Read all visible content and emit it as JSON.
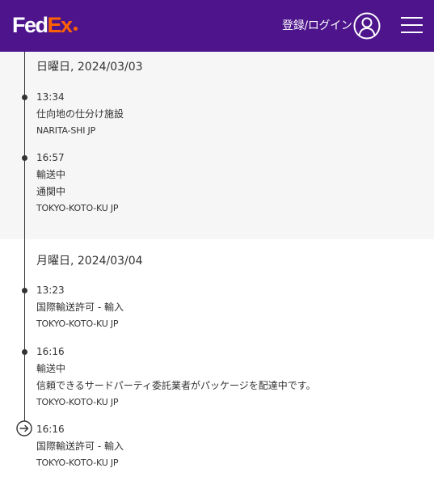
{
  "header": {
    "logo_fed": "Fed",
    "logo_ex": "Ex",
    "login_label": "登録/ログイン",
    "account_icon": "user-circle-icon",
    "menu_icon": "hamburger-menu-icon",
    "brand_color": "#4d148c",
    "accent_color": "#ff6200"
  },
  "timeline": {
    "days": [
      {
        "date": "日曜日, 2024/03/03",
        "events": [
          {
            "time": "13:34",
            "lines": [
              "仕向地の仕分け施設"
            ],
            "location": "NARITA-SHI JP"
          },
          {
            "time": "16:57",
            "lines": [
              "輸送中",
              "通関中"
            ],
            "location": "TOKYO-KOTO-KU JP"
          }
        ]
      },
      {
        "date": "月曜日, 2024/03/04",
        "events": [
          {
            "time": "13:23",
            "lines": [
              "国際輸送許可 - 輸入"
            ],
            "location": "TOKYO-KOTO-KU JP"
          },
          {
            "time": "16:16",
            "lines": [
              "輸送中",
              "信頼できるサードパーティ委託業者がパッケージを配達中です。"
            ],
            "location": "TOKYO-KOTO-KU JP"
          },
          {
            "time": "16:16",
            "lines": [
              "国際輸送許可 - 輸入"
            ],
            "location": "TOKYO-KOTO-KU JP",
            "marker_icon": "arrow-right-circle-icon"
          }
        ]
      }
    ]
  }
}
